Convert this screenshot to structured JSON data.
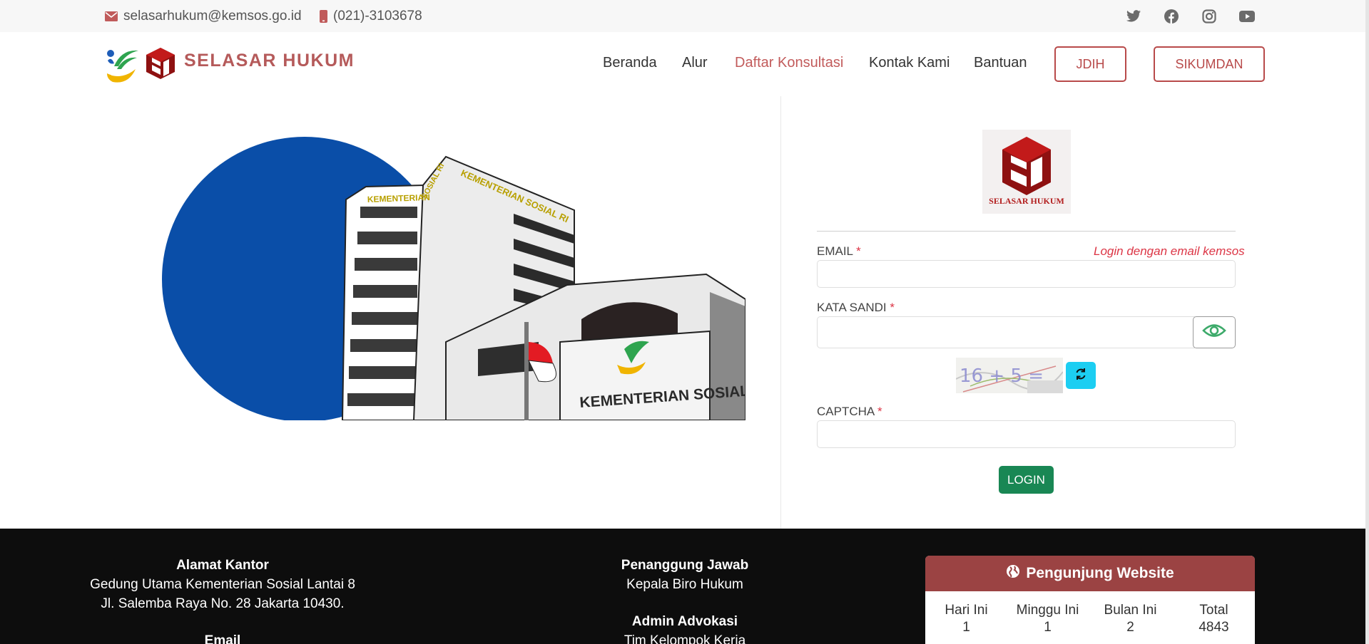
{
  "topbar": {
    "email": "selasarhukum@kemsos.go.id",
    "phone": "(021)-3103678",
    "social_icons": [
      "twitter-icon",
      "facebook-icon",
      "instagram-icon",
      "youtube-icon"
    ]
  },
  "header": {
    "brand": "SELASAR HUKUM",
    "nav": [
      "Beranda",
      "Alur",
      "Daftar Konsultasi",
      "Kontak Kami",
      "Bantuan"
    ],
    "active_nav": "Daftar Konsultasi",
    "buttons": [
      "JDIH",
      "SIKUMDAN"
    ]
  },
  "illustration": {
    "sign_top": "KEMENTERIAN",
    "sign_side": "SOSIAL RI",
    "sign_tower": "KEMENTERIAN SOSIAL RI",
    "sign_main": "KEMENTERIAN SOSIAL RI"
  },
  "login": {
    "logo_label": "SELASAR HUKUM",
    "email_label": "EMAIL",
    "email_hint": "Login dengan email kemsos",
    "email_value": "",
    "password_label": "KATA SANDI",
    "password_value": "",
    "captcha_text": "16 + 5 =",
    "captcha_label": "CAPTCHA",
    "captcha_value": "",
    "required_mark": "*",
    "submit": "LOGIN"
  },
  "footer": {
    "office_heading": "Alamat Kantor",
    "office_line1": "Gedung Utama Kementerian Sosial Lantai 8",
    "office_line2": "Jl. Salemba Raya No. 28 Jakarta 10430.",
    "email_heading": "Email",
    "pj_heading": "Penanggung Jawab",
    "pj_value": "Kepala Biro Hukum",
    "admin_heading": "Admin Advokasi",
    "admin_value": "Tim Kelompok Kerja",
    "visitor": {
      "title": "Pengunjung Website",
      "stats": [
        {
          "label": "Hari Ini",
          "value": "1"
        },
        {
          "label": "Minggu Ini",
          "value": "1"
        },
        {
          "label": "Bulan Ini",
          "value": "2"
        },
        {
          "label": "Total",
          "value": "4843"
        }
      ]
    }
  },
  "colors": {
    "brand_red": "#b84a4a",
    "visitor_header": "#9b4343",
    "login_green": "#198754",
    "refresh_cyan": "#1ccef2",
    "circle_blue": "#0a4ea8"
  }
}
